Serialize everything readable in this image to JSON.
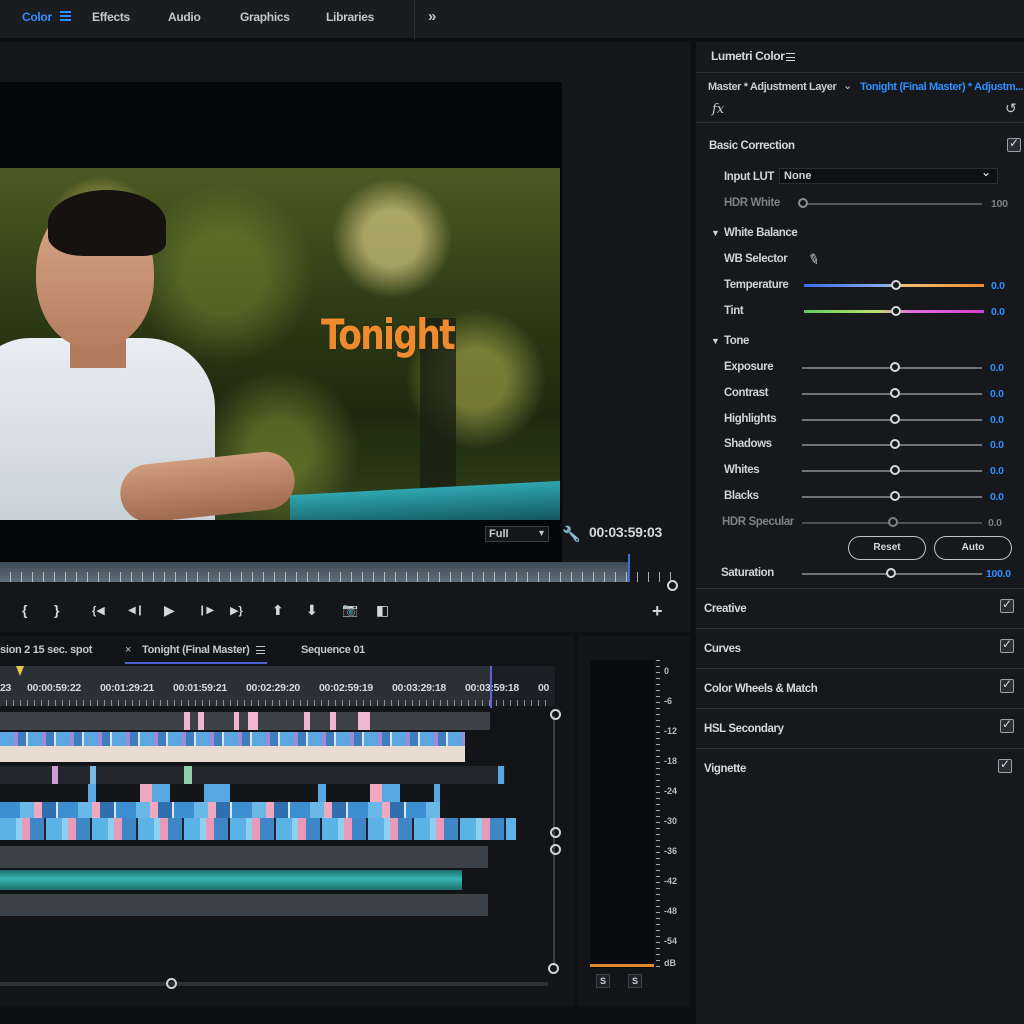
{
  "workspaces": {
    "tabs": [
      "Color",
      "Effects",
      "Audio",
      "Graphics",
      "Libraries"
    ],
    "active": "Color",
    "more": "»"
  },
  "program": {
    "title_overlay": "Tonight",
    "zoom": "Full",
    "timecode": "00:03:59:03"
  },
  "transport": {
    "mark_in": "{",
    "mark_out": "}",
    "go_to_in": "{◀",
    "step_back": "◀❙",
    "play": "▶",
    "step_forward": "❙▶",
    "go_to_out": "▶}",
    "lift": "⬆",
    "extract": "⬇",
    "export_frame": "📷",
    "compare": "◧",
    "add": "+"
  },
  "timeline": {
    "tabs": [
      "sion 2 15 sec. spot",
      "Tonight (Final Master)",
      "Sequence 01"
    ],
    "close": "×",
    "ruler": [
      "23",
      "00:00:59:22",
      "00:01:29:21",
      "00:01:59:21",
      "00:02:29:20",
      "00:02:59:19",
      "00:03:29:18",
      "00:03:59:18",
      "00"
    ]
  },
  "meter": {
    "scale": [
      "0",
      "-6",
      "-12",
      "-18",
      "-24",
      "-30",
      "-36",
      "-42",
      "-48",
      "-54",
      "dB"
    ],
    "solo": [
      "S",
      "S"
    ]
  },
  "lumetri": {
    "title": "Lumetri Color",
    "master": "Master * Adjustment Layer",
    "sequence": "Tonight (Final Master) * Adjustm...",
    "fx": "fx",
    "basic_correction": "Basic Correction",
    "input_lut_label": "Input LUT",
    "input_lut_value": "None",
    "hdr_white_label": "HDR White",
    "hdr_white_value": "100",
    "white_balance": "White Balance",
    "wb_selector": "WB Selector",
    "temperature": {
      "label": "Temperature",
      "value": "0.0"
    },
    "tint": {
      "label": "Tint",
      "value": "0.0"
    },
    "tone": "Tone",
    "tone_rows": [
      {
        "label": "Exposure",
        "value": "0.0"
      },
      {
        "label": "Contrast",
        "value": "0.0"
      },
      {
        "label": "Highlights",
        "value": "0.0"
      },
      {
        "label": "Shadows",
        "value": "0.0"
      },
      {
        "label": "Whites",
        "value": "0.0"
      },
      {
        "label": "Blacks",
        "value": "0.0"
      }
    ],
    "hdr_specular": {
      "label": "HDR Specular",
      "value": "0.0"
    },
    "reset": "Reset",
    "auto": "Auto",
    "saturation": {
      "label": "Saturation",
      "value": "100.0"
    },
    "sections": [
      "Creative",
      "Curves",
      "Color Wheels & Match",
      "HSL Secondary",
      "Vignette"
    ]
  },
  "colors": {
    "accent": "#2f8fff",
    "title_orange": "#f08a2e"
  }
}
